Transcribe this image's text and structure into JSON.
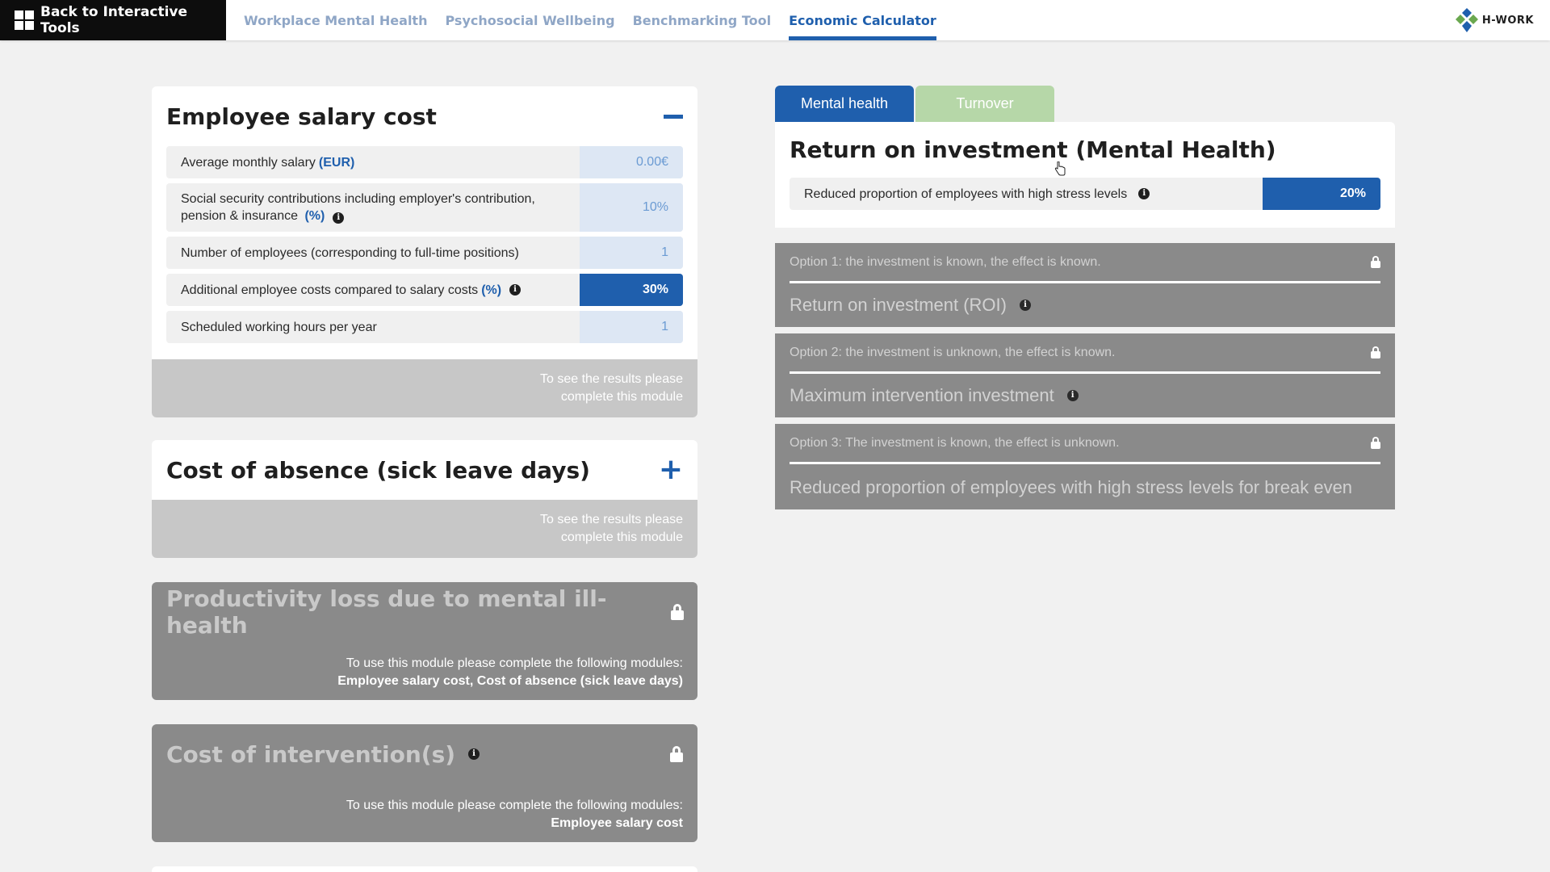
{
  "nav": {
    "back_label": "Back to Interactive Tools",
    "tabs": [
      "Workplace Mental Health",
      "Psychosocial Wellbeing",
      "Benchmarking Tool",
      "Economic Calculator"
    ],
    "active_tab": "Economic Calculator",
    "logo_text": "H-WORK"
  },
  "salary": {
    "title": "Employee salary cost",
    "rows": [
      {
        "label": "Average monthly salary",
        "unit": "(EUR)",
        "value": "0.00€"
      },
      {
        "label": "Social security contributions including employer's contribution, pension & insurance",
        "unit": "(%)",
        "value": "10%"
      },
      {
        "label": "Number of employees (corresponding to full-time positions)",
        "unit": "",
        "value": "1"
      },
      {
        "label": "Additional employee costs compared to salary costs",
        "unit": "(%)",
        "value": "30%"
      },
      {
        "label": "Scheduled working hours per year",
        "unit": "",
        "value": "1"
      }
    ],
    "results_line1": "To see the results please",
    "results_line2": "complete this module"
  },
  "absence": {
    "title": "Cost of absence (sick leave days)",
    "results_line1": "To see the results please",
    "results_line2": "complete this module"
  },
  "productivity": {
    "title": "Productivity loss due to mental ill-health",
    "text": "To use this module please complete the following modules:",
    "modules": "Employee salary cost, Cost of absence (sick leave days)"
  },
  "intervention": {
    "title": "Cost of intervention(s)",
    "text": "To use this module please complete the following modules:",
    "modules": "Employee salary cost"
  },
  "right": {
    "tabs": {
      "mental": "Mental health",
      "turnover": "Turnover"
    },
    "title": "Return on investment (Mental Health)",
    "row_label": "Reduced proportion of employees with high stress levels",
    "row_value": "20%",
    "options": [
      {
        "head": "Option 1: the investment is known, the effect is known.",
        "title": "Return on investment (ROI)"
      },
      {
        "head": "Option 2: the investment is unknown, the effect is known.",
        "title": "Maximum intervention investment"
      },
      {
        "head": "Option 3: The investment is known, the effect is unknown.",
        "title": "Reduced proportion of employees with high stress levels for break even"
      }
    ]
  },
  "colors": {
    "accent": "#1f5fad",
    "locked": "#8a8a8a",
    "turnover_tab": "#b6d7a8"
  }
}
